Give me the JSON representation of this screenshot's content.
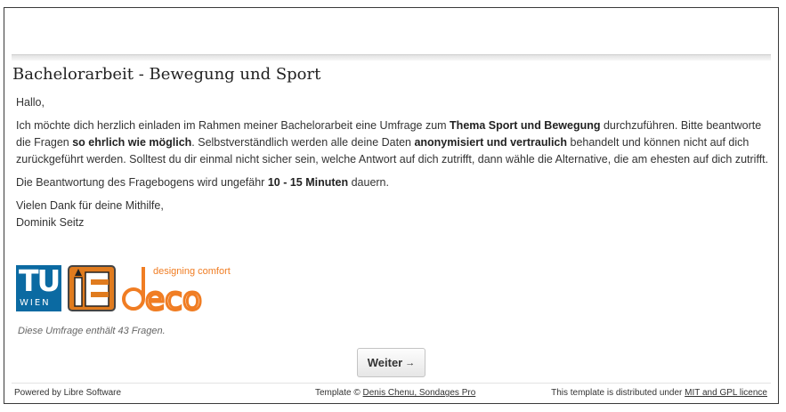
{
  "survey": {
    "title": "Bachelorarbeit - Bewegung und Sport",
    "greeting": "Hallo,",
    "p1": {
      "t1": "Ich möchte dich herzlich einladen im Rahmen meiner Bachelorarbeit eine Umfrage zum ",
      "b1": "Thema Sport und Bewegung",
      "t2": " durchzuführen. Bitte beantworte die Fragen ",
      "b2": "so ehrlich wie möglich",
      "t3": ". Selbstverständlich werden alle deine Daten ",
      "b3": "anonymisiert und vertraulich",
      "t4": " behandelt und können nicht auf dich zurückgeführt werden. Solltest du dir einmal nicht sicher sein, welche Antwort auf dich zutrifft, dann wähle die Alternative, die am ehesten auf dich zutrifft."
    },
    "p2": {
      "t1": "Die Beantwortung des Fragebogens wird ungefähr ",
      "b1": "10 - 15 Minuten",
      "t2": " dauern."
    },
    "thanks": "Vielen Dank für deine Mithilfe,",
    "author": "Dominik Seitz",
    "logos": {
      "tu_text": "TU",
      "wien_text": "WIEN",
      "ie_text": "IE",
      "deco_tagline": "designing comfort",
      "deco_text": "deco"
    },
    "question_count_text": "Diese Umfrage enthält 43 Fragen.",
    "next_button": "Weiter",
    "next_icon": "→"
  },
  "footer": {
    "left": "Powered by Libre Software",
    "center_prefix": "Template © ",
    "center_link": "Denis Chenu, Sondages Pro",
    "right_prefix": "This template is distributed under ",
    "right_link": "MIT and GPL licence"
  },
  "colors": {
    "tu_blue": "#0b6aa2",
    "ie_orange": "#e07b1e",
    "deco_orange": "#f07d23"
  }
}
